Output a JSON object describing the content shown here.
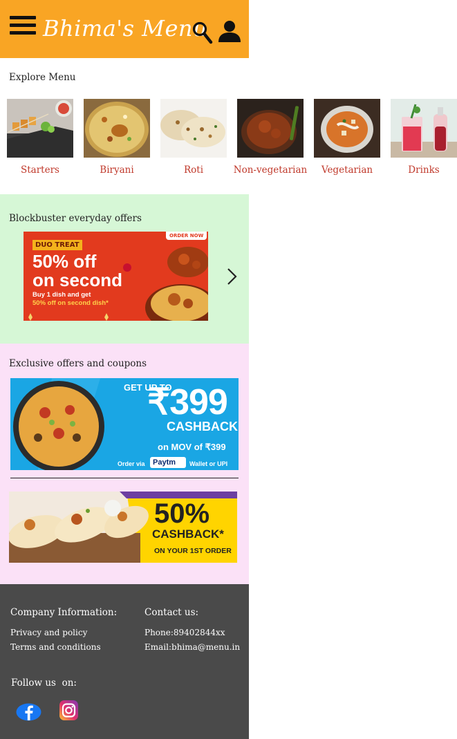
{
  "header": {
    "logo": "Bhima's Menu",
    "background": "#f9a524"
  },
  "explore": {
    "title": "Explore Menu",
    "categories": [
      {
        "label": "Starters"
      },
      {
        "label": "Biryani"
      },
      {
        "label": "Roti"
      },
      {
        "label": "Non-vegetarian"
      },
      {
        "label": "Vegetarian"
      },
      {
        "label": "Drinks"
      }
    ]
  },
  "offers": {
    "title": "Blockbuster everyday offers",
    "banner": {
      "tag": "DUO TREAT",
      "headline_1": "50% off",
      "headline_2": "on second",
      "line_1": "Buy 1 dish and get",
      "line_2": "50% off on second dish*",
      "order_now": "ORDER NOW"
    },
    "background": "#d6f7d6"
  },
  "coupons": {
    "title": "Exclusive offers and coupons",
    "paytm": {
      "get_up_to": "GET UP TO",
      "amount": "₹399",
      "cashback": "CASHBACK",
      "mov": "on MOV of ₹399",
      "order_via": "Order via",
      "paytm": "Paytm",
      "wallet": "Wallet or UPI"
    },
    "wrap": {
      "percent": "50%",
      "cashback": "CASHBACK*",
      "first_order": "ON YOUR 1ST ORDER"
    },
    "background": "#fbe1f7"
  },
  "footer": {
    "company_heading": "Company Information:",
    "privacy": "Privacy and policy",
    "terms": "Terms and conditions",
    "contact_heading": "Contact us:",
    "phone": "Phone:89402844xx",
    "email": "Email:bhima@menu.in",
    "follow": "Follow us  on:",
    "background": "#4a4a4a"
  }
}
